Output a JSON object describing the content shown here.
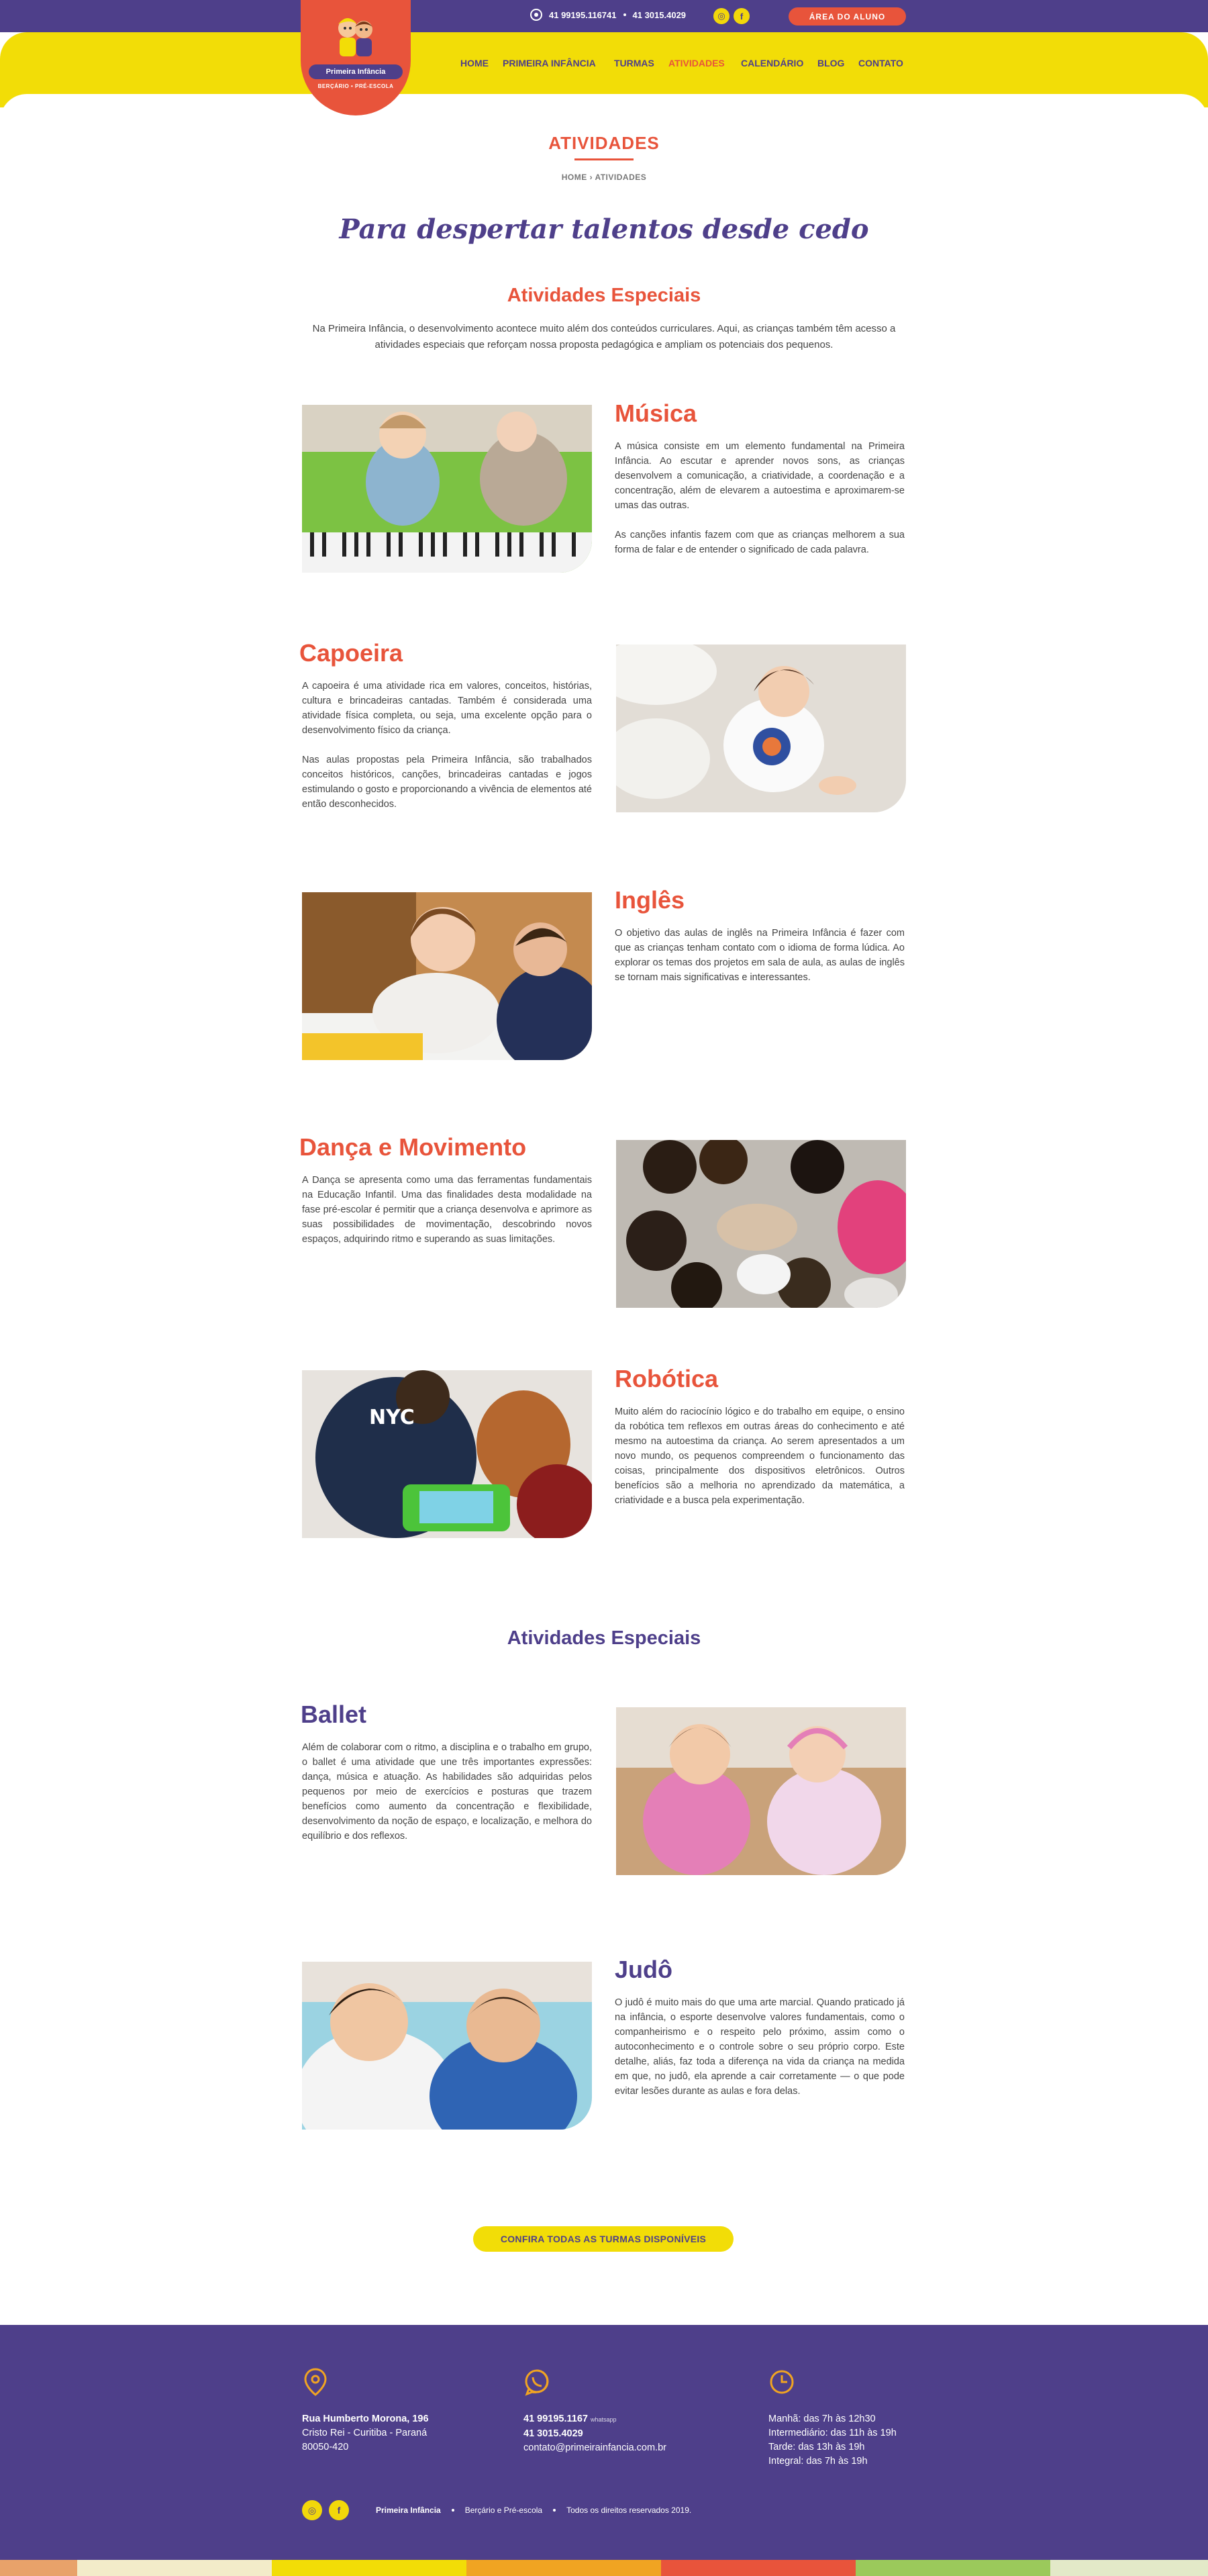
{
  "topbar": {
    "phone1": "41 99195.116741",
    "phone2": "41 3015.4029",
    "social": [
      "instagram-icon",
      "facebook-icon"
    ],
    "student_area": "ÁREA DO ALUNO"
  },
  "logo": {
    "name": "Primeira Infância",
    "subtitle": "BERÇÁRIO • PRÉ-ESCOLA"
  },
  "nav": {
    "items": [
      {
        "label": "HOME"
      },
      {
        "label": "PRIMEIRA INFÂNCIA"
      },
      {
        "label": "TURMAS"
      },
      {
        "label": "ATIVIDADES",
        "active": true
      },
      {
        "label": "CALENDÁRIO"
      },
      {
        "label": "BLOG"
      },
      {
        "label": "CONTATO"
      }
    ]
  },
  "page": {
    "title": "ATIVIDADES",
    "breadcrumb": "HOME › ATIVIDADES",
    "tagline": "Para despertar talentos desde cedo"
  },
  "section1": {
    "heading": "Atividades Especiais",
    "intro": "Na Primeira Infância, o desenvolvimento acontece muito além dos conteúdos curriculares. Aqui, as crianças também têm acesso a atividades especiais que reforçam nossa proposta pedagógica e ampliam os potenciais dos pequenos."
  },
  "activities": [
    {
      "title": "Música",
      "paragraphs": [
        "A música consiste em um elemento fundamental na Primeira Infância. Ao escutar e aprender novos sons, as crianças desenvolvem a comunicação, a criatividade, a coordenação e a concentração, além de elevarem a autoestima e aproximarem-se umas das outras.",
        "As canções infantis fazem com que as crianças melhorem a sua forma de falar e de entender o significado de cada palavra."
      ]
    },
    {
      "title": "Capoeira",
      "paragraphs": [
        "A capoeira é uma atividade rica em valores, conceitos, histórias, cultura e brincadeiras cantadas. Também é considerada uma atividade física completa, ou seja, uma excelente opção para o desenvolvimento físico da criança.",
        "Nas aulas propostas pela Primeira Infância, são trabalhados conceitos históricos, canções, brincadeiras cantadas e jogos estimulando o gosto e proporcionando a vivência de elementos até então desconhecidos."
      ]
    },
    {
      "title": "Inglês",
      "paragraphs": [
        "O objetivo das aulas de inglês na Primeira Infância é fazer com que as crianças tenham contato com o idioma de forma lúdica. Ao explorar os temas dos projetos em sala de aula, as aulas de inglês se tornam mais significativas e interessantes."
      ]
    },
    {
      "title": "Dança e Movimento",
      "paragraphs": [
        "A Dança se apresenta como uma das ferramentas fundamentais na Educação Infantil. Uma das finalidades desta modalidade na fase pré-escolar é permitir que a criança desenvolva e aprimore as suas possibilidades de movimentação, descobrindo novos espaços, adquirindo ritmo e superando as suas limitações."
      ]
    },
    {
      "title": "Robótica",
      "paragraphs": [
        "Muito além do raciocínio lógico e do trabalho em equipe, o ensino da robótica tem reflexos em outras áreas do conhecimento e até mesmo na autoestima da criança. Ao serem apresentados a um novo mundo, os pequenos compreendem o funcionamento das coisas, principalmente dos dispositivos eletrônicos. Outros benefícios são a melhoria no aprendizado da matemática, a criatividade e a busca pela experimentação."
      ]
    }
  ],
  "section2": {
    "heading": "Atividades Especiais"
  },
  "activities2": [
    {
      "title": "Ballet",
      "paragraphs": [
        "Além de colaborar com o ritmo, a disciplina e o trabalho em grupo, o ballet é uma atividade que une três importantes expressões: dança, música e atuação. As habilidades são adquiridas pelos pequenos por meio de exercícios e posturas que trazem benefícios como aumento da concentração e flexibilidade, desenvolvimento da noção de espaço, e localização, e melhora do equilíbrio e dos reflexos."
      ]
    },
    {
      "title": "Judô",
      "paragraphs": [
        "O judô é muito mais do que uma arte marcial. Quando praticado já na infância, o esporte desenvolve valores fundamentais, como o companheirismo e o respeito pelo próximo, assim como o autoconhecimento e o controle sobre o seu próprio corpo. Este detalhe, aliás, faz toda a diferença na vida da criança na medida em que, no judô, ela aprende a cair corretamente — o que pode evitar lesões durante as aulas e fora delas."
      ]
    }
  ],
  "cta": {
    "label": "CONFIRA TODAS AS TURMAS DISPONÍVEIS"
  },
  "footer": {
    "address": {
      "street": "Rua Humberto Morona, 196",
      "city": "Cristo Rei  -  Curitiba  -  Paraná",
      "zip": "80050-420"
    },
    "contact": {
      "phone1": "41 99195.1167",
      "phone1_note": "whatsapp",
      "phone2": "41 3015.4029",
      "email": "contato@primeirainfancia.com.br"
    },
    "hours": [
      "Manhã: das 7h às 12h30",
      "Intermediário: das 11h às 19h",
      "Tarde: das 13h às 19h",
      "Integral: das 7h às 19h"
    ],
    "bottom": {
      "brand": "Primeira Infância",
      "desc": "Berçário e Pré-escola",
      "rights": "Todos os direitos reservados 2019."
    }
  },
  "colors": {
    "purple": "#4e3f8a",
    "orange": "#e8543b",
    "yellow": "#f2dd07"
  }
}
